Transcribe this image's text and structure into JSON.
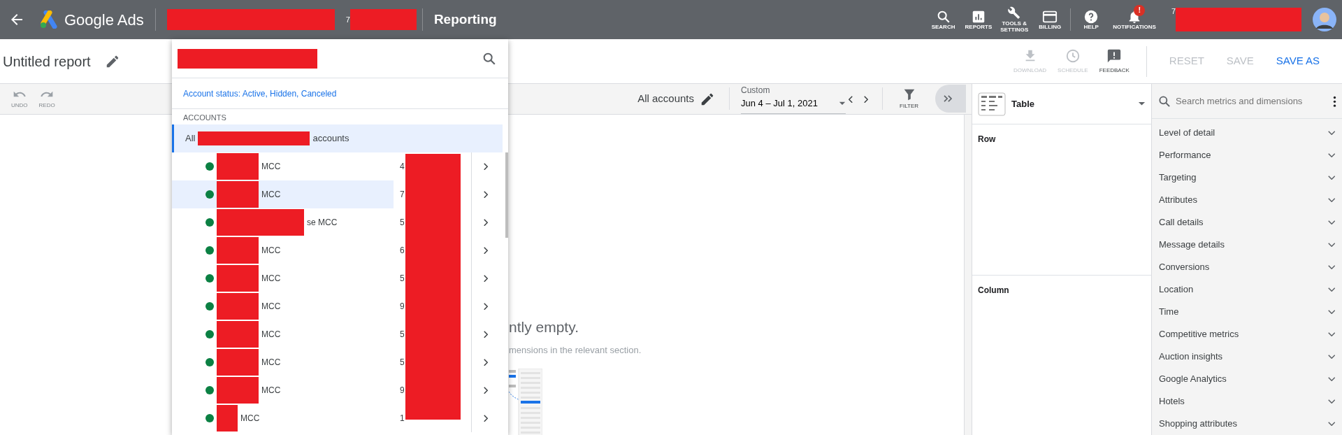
{
  "top_bar": {
    "brand": "Google Ads",
    "account_id_fragment": "7",
    "page_title": "Reporting",
    "user_id_fragment": "7",
    "notification_badge": "!",
    "nav": [
      {
        "label": "SEARCH"
      },
      {
        "label": "REPORTS"
      },
      {
        "label": "TOOLS & SETTINGS"
      },
      {
        "label": "BILLING"
      },
      {
        "label": "HELP"
      },
      {
        "label": "NOTIFICATIONS"
      }
    ]
  },
  "report": {
    "title": "Untitled report",
    "actions": [
      {
        "label": "DOWNLOAD",
        "disabled": true
      },
      {
        "label": "SCHEDULE",
        "disabled": true
      },
      {
        "label": "FEEDBACK",
        "disabled": false
      }
    ],
    "buttons": [
      {
        "label": "RESET",
        "disabled": true
      },
      {
        "label": "SAVE",
        "disabled": true
      },
      {
        "label": "SAVE AS",
        "disabled": false
      }
    ]
  },
  "toolbar": {
    "history": [
      {
        "label": "UNDO",
        "disabled": true
      },
      {
        "label": "REDO",
        "disabled": true
      }
    ],
    "scope": "All accounts",
    "date_range": {
      "label": "Custom",
      "value": "Jun 4 – Jul 1, 2021"
    },
    "filter": "FILTER"
  },
  "empty_state": {
    "title": "ntly empty.",
    "hint": "mensions in the relevant section."
  },
  "account_picker": {
    "status_filter": "Account status: Active, Hidden, Canceled",
    "section": "ACCOUNTS",
    "all_row": {
      "prefix": "All",
      "suffix": "accounts",
      "selected": true
    },
    "accounts": [
      {
        "name": "MCC",
        "id": "4",
        "hovered": false,
        "color": "#0b8043"
      },
      {
        "name": "MCC",
        "id": "7",
        "hovered": true,
        "color": "#0b8043"
      },
      {
        "name": "se MCC",
        "id": "5",
        "hovered": false,
        "color": "#0b8043"
      },
      {
        "name": "MCC",
        "id": "6",
        "hovered": false,
        "color": "#0b8043"
      },
      {
        "name": "MCC",
        "id": "5",
        "hovered": false,
        "color": "#0b8043"
      },
      {
        "name": "MCC",
        "id": "9",
        "hovered": false,
        "color": "#0b8043"
      },
      {
        "name": "MCC",
        "id": "5",
        "hovered": false,
        "color": "#0b8043"
      },
      {
        "name": "MCC",
        "id": "5",
        "hovered": false,
        "color": "#0b8043"
      },
      {
        "name": "MCC",
        "id": "9",
        "hovered": false,
        "color": "#0b8043"
      },
      {
        "name": "MCC",
        "id": "1",
        "hovered": false,
        "color": "#0b8043"
      }
    ]
  },
  "chart_type": {
    "value": "Table"
  },
  "layout_sections": [
    {
      "label": "Row"
    },
    {
      "label": "Column"
    }
  ],
  "dimension_search": {
    "placeholder": "Search metrics and dimensions"
  },
  "categories": [
    {
      "label": "Level of detail",
      "expanded": false
    },
    {
      "label": "Performance",
      "expanded": false
    },
    {
      "label": "Targeting",
      "expanded": false
    },
    {
      "label": "Attributes",
      "expanded": false
    },
    {
      "label": "Call details",
      "expanded": false
    },
    {
      "label": "Message details",
      "expanded": false
    },
    {
      "label": "Conversions",
      "expanded": false
    },
    {
      "label": "Location",
      "expanded": false
    },
    {
      "label": "Time",
      "expanded": false
    },
    {
      "label": "Competitive metrics",
      "expanded": false
    },
    {
      "label": "Auction insights",
      "expanded": false
    },
    {
      "label": "Google Analytics",
      "expanded": false
    },
    {
      "label": "Hotels",
      "expanded": false
    },
    {
      "label": "Shopping attributes",
      "expanded": false
    }
  ]
}
